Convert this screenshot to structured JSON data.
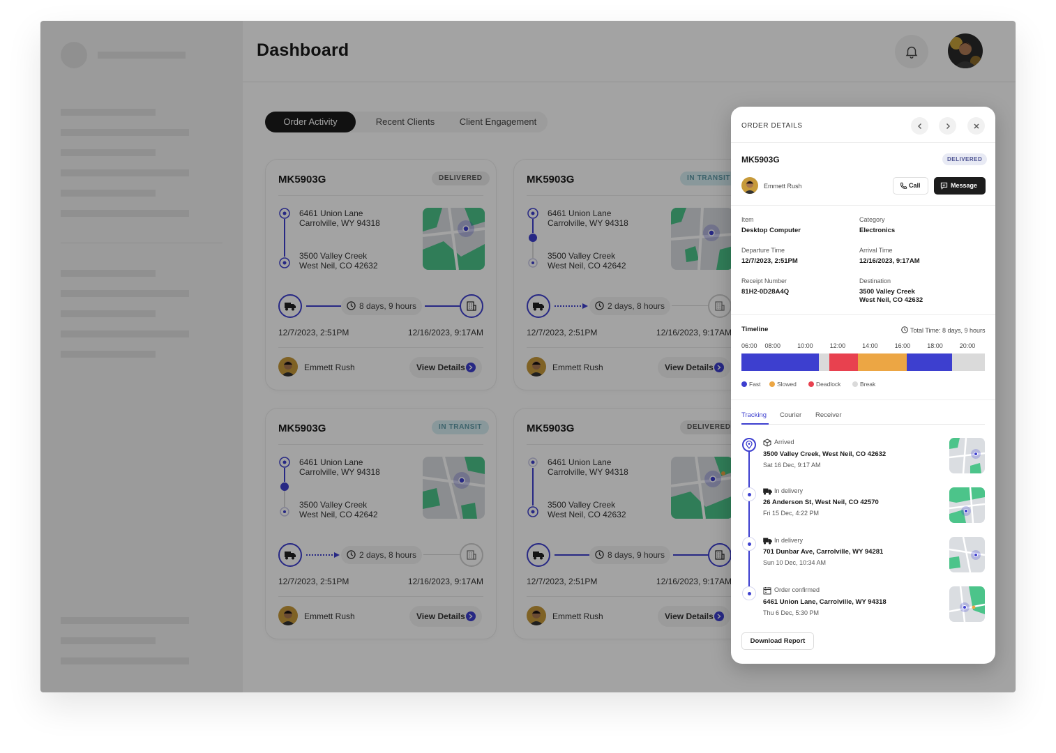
{
  "header": {
    "title": "Dashboard"
  },
  "tabs": [
    {
      "label": "Order Activity",
      "active": true
    },
    {
      "label": "Recent Clients",
      "active": false
    },
    {
      "label": "Client Engagement",
      "active": false
    }
  ],
  "cards": [
    {
      "id": "MK5903G",
      "status": "DELIVERED",
      "from_line1": "6461 Union Lane",
      "from_line2": "Carrolville, WY 94318",
      "to_line1": "3500 Valley Creek",
      "to_line2": "West Neil, CO 42632",
      "duration": "8 days, 9 hours",
      "start": "12/7/2023, 2:51PM",
      "end": "12/16/2023, 9:17AM",
      "person": "Emmett Rush",
      "action": "View Details"
    },
    {
      "id": "MK5903G",
      "status": "IN TRANSIT",
      "from_line1": "6461 Union Lane",
      "from_line2": "Carrolville, WY 94318",
      "to_line1": "3500 Valley Creek",
      "to_line2": "West Neil, CO 42642",
      "duration": "2 days, 8 hours",
      "start": "12/7/2023, 2:51PM",
      "end": "12/16/2023, 9:17AM",
      "person": "Emmett Rush",
      "action": "View Details"
    },
    {
      "id": "MK5903G",
      "status": "IN TRANSIT",
      "from_line1": "6461 Union Lane",
      "from_line2": "Carrolville, WY 94318",
      "to_line1": "3500 Valley Creek",
      "to_line2": "West Neil, CO 42642",
      "duration": "2 days, 8 hours",
      "start": "12/7/2023, 2:51PM",
      "end": "12/16/2023, 9:17AM",
      "person": "Emmett Rush",
      "action": "View Details"
    },
    {
      "id": "MK5903G",
      "status": "DELIVERED",
      "from_line1": "6461 Union Lane",
      "from_line2": "Carrolville, WY 94318",
      "to_line1": "3500 Valley Creek",
      "to_line2": "West Neil, CO 42632",
      "duration": "8 days, 9 hours",
      "start": "12/7/2023, 2:51PM",
      "end": "12/16/2023, 9:17AM",
      "person": "Emmett Rush",
      "action": "View Details"
    }
  ],
  "panel": {
    "title": "ORDER DETAILS",
    "order_id": "MK5903G",
    "status": "DELIVERED",
    "person": "Emmett Rush",
    "call_label": "Call",
    "message_label": "Message",
    "fields": {
      "item_label": "Item",
      "item_value": "Desktop Computer",
      "category_label": "Category",
      "category_value": "Electronics",
      "departure_label": "Departure Time",
      "departure_value": "12/7/2023, 2:51PM",
      "arrival_label": "Arrival Time",
      "arrival_value": "12/16/2023, 9:17AM",
      "receipt_label": "Receipt Number",
      "receipt_value": "81H2-0D28A4Q",
      "destination_label": "Destination",
      "destination_line1": "3500 Valley Creek",
      "destination_line2": "West Neil, CO 42632"
    },
    "timeline": {
      "title": "Timeline",
      "total": "Total Time: 8 days, 9 hours",
      "hours": [
        "06:00",
        "08:00",
        "10:00",
        "12:00",
        "14:00",
        "16:00",
        "18:00",
        "20:00"
      ],
      "segments": [
        {
          "type": "Fast",
          "from": "06:00",
          "to": "10:45"
        },
        {
          "type": "Break",
          "from": "10:45",
          "to": "11:25"
        },
        {
          "type": "Deadlock",
          "from": "11:25",
          "to": "13:10"
        },
        {
          "type": "Slowed",
          "from": "13:10",
          "to": "16:10"
        },
        {
          "type": "Fast",
          "from": "16:10",
          "to": "19:00"
        },
        {
          "type": "Break",
          "from": "19:00",
          "to": "21:00"
        }
      ],
      "legend": [
        {
          "label": "Fast",
          "color": "#3d3fcf"
        },
        {
          "label": "Slowed",
          "color": "#eca644"
        },
        {
          "label": "Deadlock",
          "color": "#e8414f"
        },
        {
          "label": "Break",
          "color": "#dadada"
        }
      ]
    },
    "sub_tabs": [
      {
        "label": "Tracking",
        "active": true
      },
      {
        "label": "Courier",
        "active": false
      },
      {
        "label": "Receiver",
        "active": false
      }
    ],
    "tracking": [
      {
        "status": "Arrived",
        "icon": "package-icon",
        "address": "3500 Valley Creek, West Neil, CO 42632",
        "time": "Sat 16 Dec, 9:17 AM"
      },
      {
        "status": "In delivery",
        "icon": "truck-icon",
        "address": "26 Anderson St, West Neil, CO 42570",
        "time": "Fri 15 Dec, 4:22 PM"
      },
      {
        "status": "In delivery",
        "icon": "truck-icon",
        "address": "701 Dunbar Ave, Carrolville, WY 94281",
        "time": "Sun 10 Dec, 10:34 AM"
      },
      {
        "status": "Order confirmed",
        "icon": "calendar-icon",
        "address": "6461 Union Lane, Carrolville, WY 94318",
        "time": "Thu 6 Dec, 5:30 PM"
      }
    ],
    "download_label": "Download Report"
  },
  "colors": {
    "accent": "#3d3fcf",
    "dark": "#1c1c1c",
    "transit_badge": "#d6eef2"
  }
}
